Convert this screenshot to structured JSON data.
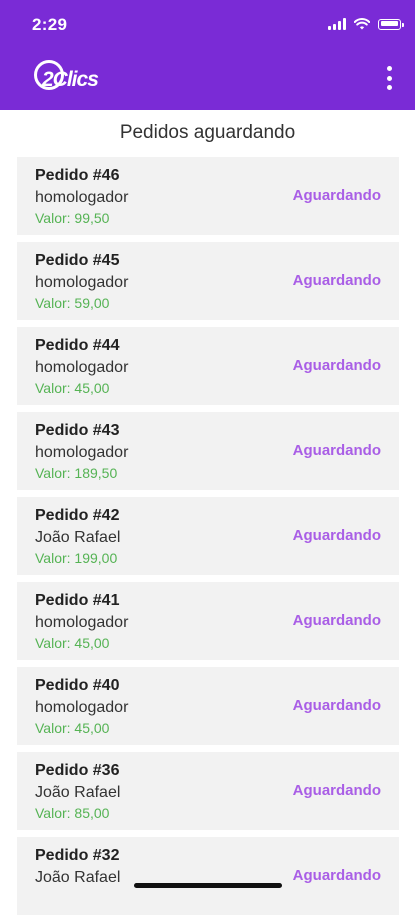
{
  "status_bar": {
    "time": "2:29"
  },
  "app": {
    "logo_text": "2Clics",
    "menu_icon": "more-vertical-icon"
  },
  "page": {
    "title": "Pedidos aguardando"
  },
  "orders": [
    {
      "title": "Pedido #46",
      "customer": "homologador",
      "value": "Valor:  99,50",
      "status": "Aguardando"
    },
    {
      "title": "Pedido #45",
      "customer": "homologador",
      "value": "Valor:  59,00",
      "status": "Aguardando"
    },
    {
      "title": "Pedido #44",
      "customer": "homologador",
      "value": "Valor:  45,00",
      "status": "Aguardando"
    },
    {
      "title": "Pedido #43",
      "customer": "homologador",
      "value": "Valor:  189,50",
      "status": "Aguardando"
    },
    {
      "title": "Pedido #42",
      "customer": "João Rafael",
      "value": "Valor:  199,00",
      "status": "Aguardando"
    },
    {
      "title": "Pedido #41",
      "customer": "homologador",
      "value": "Valor:  45,00",
      "status": "Aguardando"
    },
    {
      "title": "Pedido #40",
      "customer": "homologador",
      "value": "Valor:  45,00",
      "status": "Aguardando"
    },
    {
      "title": "Pedido #36",
      "customer": "João Rafael",
      "value": "Valor:  85,00",
      "status": "Aguardando"
    },
    {
      "title": "Pedido #32",
      "customer": "João Rafael",
      "value": "",
      "status": "Aguardando"
    }
  ],
  "colors": {
    "header": "#7a2bd6",
    "status": "#a95ee6",
    "value": "#55b354",
    "card": "#f2f2f2"
  }
}
